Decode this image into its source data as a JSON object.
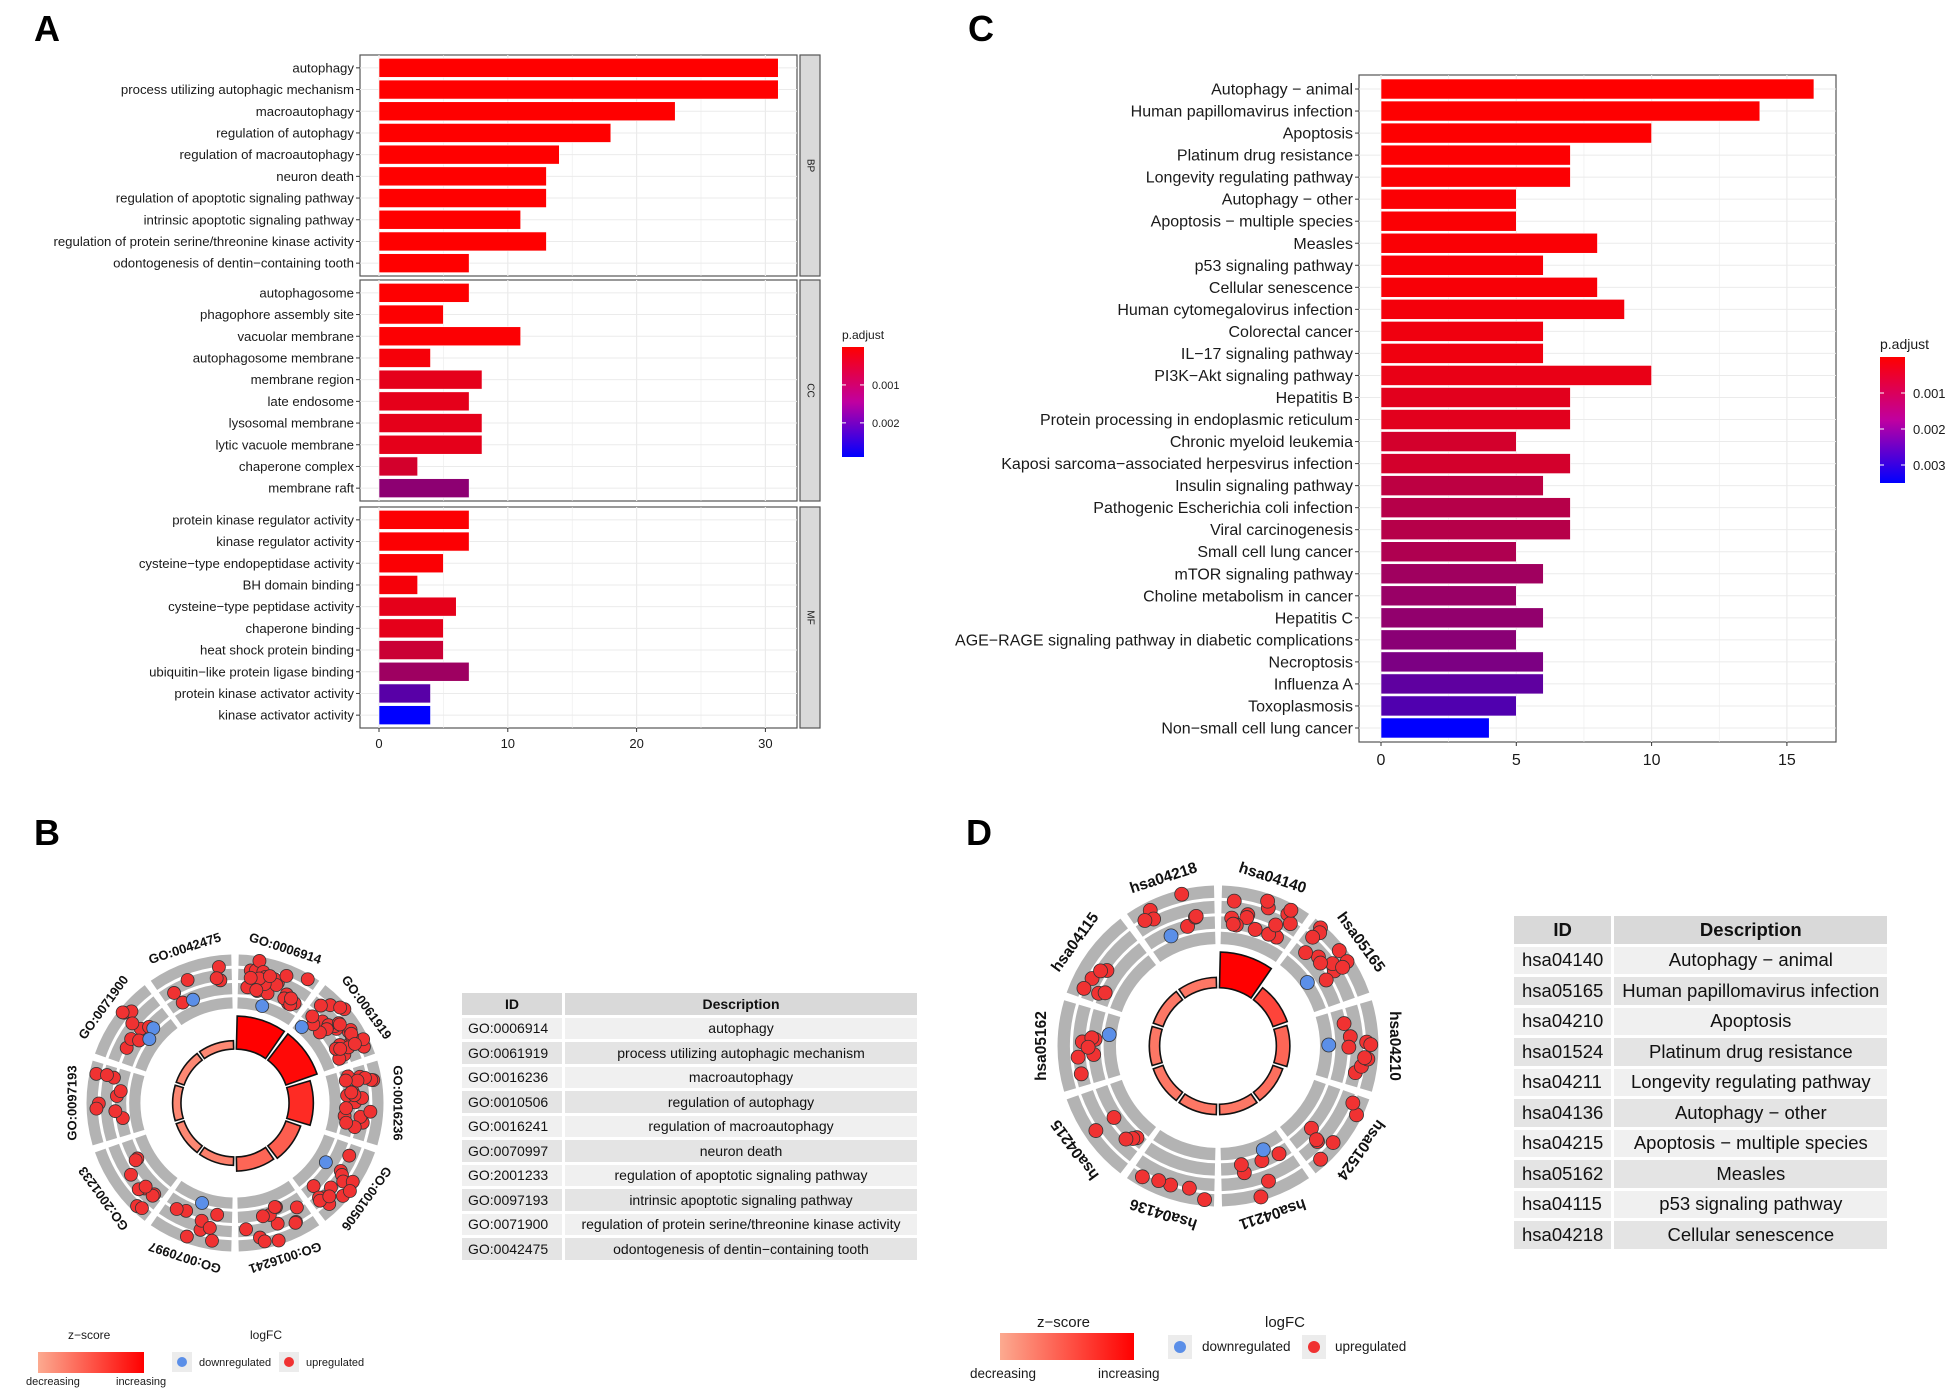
{
  "panels": {
    "A": "A",
    "B": "B",
    "C": "C",
    "D": "D"
  },
  "chart_data": [
    {
      "id": "A",
      "type": "bar",
      "orientation": "horizontal",
      "title": "",
      "xlabel": "",
      "ylabel": "",
      "xlim": [
        0,
        33
      ],
      "xticks": [
        0,
        10,
        20,
        30
      ],
      "grid": true,
      "facets": [
        {
          "name": "BP",
          "categories": [
            "autophagy",
            "process utilizing autophagic mechanism",
            "macroautophagy",
            "regulation of autophagy",
            "regulation of macroautophagy",
            "neuron death",
            "regulation of apoptotic signaling pathway",
            "intrinsic apoptotic signaling pathway",
            "regulation of protein serine/threonine kinase activity",
            "odontogenesis of dentin−containing tooth"
          ],
          "values": [
            31,
            31,
            23,
            18,
            14,
            13,
            13,
            11,
            13,
            7
          ],
          "p_adjust": [
            1e-08,
            1e-08,
            2e-08,
            5e-08,
            1e-07,
            2e-07,
            3e-07,
            3e-07,
            4e-07,
            5e-07
          ]
        },
        {
          "name": "CC",
          "categories": [
            "autophagosome",
            "phagophore assembly site",
            "vacuolar membrane",
            "autophagosome membrane",
            "membrane region",
            "late endosome",
            "lysosomal membrane",
            "lytic vacuole membrane",
            "chaperone complex",
            "membrane raft"
          ],
          "values": [
            7,
            5,
            11,
            4,
            8,
            7,
            8,
            8,
            3,
            7
          ],
          "p_adjust": [
            1e-05,
            2e-05,
            3e-05,
            0.0001,
            0.0003,
            0.0003,
            0.0003,
            0.0003,
            0.0005,
            0.0013
          ]
        },
        {
          "name": "MF",
          "categories": [
            "protein kinase regulator activity",
            "kinase regulator activity",
            "cysteine−type endopeptidase activity",
            "BH domain binding",
            "cysteine−type peptidase activity",
            "chaperone binding",
            "heat shock protein binding",
            "ubiquitin−like protein ligase binding",
            "protein kinase activator activity",
            "kinase activator activity"
          ],
          "values": [
            7,
            7,
            5,
            3,
            6,
            5,
            5,
            7,
            4,
            4
          ],
          "p_adjust": [
            3e-05,
            3e-05,
            5e-05,
            0.0001,
            0.0003,
            0.0003,
            0.0006,
            0.0011,
            0.0019,
            0.0029
          ]
        }
      ],
      "legend": {
        "title": "p.adjust",
        "ticks": [
          "0.001",
          "0.002"
        ],
        "tick_values": [
          0.001,
          0.002
        ],
        "range": [
          0,
          0.0029
        ],
        "low_color": "#ff0000",
        "high_color": "#0000ff",
        "position": "right"
      }
    },
    {
      "id": "C",
      "type": "bar",
      "orientation": "horizontal",
      "title": "",
      "xlabel": "",
      "ylabel": "",
      "xlim": [
        0,
        16.8
      ],
      "xticks": [
        0,
        5,
        10,
        15
      ],
      "grid": true,
      "categories": [
        "Autophagy − animal",
        "Human papillomavirus infection",
        "Apoptosis",
        "Platinum drug resistance",
        "Longevity regulating pathway",
        "Autophagy − other",
        "Apoptosis − multiple species",
        "Measles",
        "p53 signaling pathway",
        "Cellular senescence",
        "Human cytomegalovirus infection",
        "Colorectal cancer",
        "IL−17 signaling pathway",
        "PI3K−Akt signaling pathway",
        "Hepatitis B",
        "Protein processing in endoplasmic reticulum",
        "Chronic myeloid leukemia",
        "Kaposi sarcoma−associated herpesvirus infection",
        "Insulin signaling pathway",
        "Pathogenic Escherichia coli infection",
        "Viral carcinogenesis",
        "Small cell lung cancer",
        "mTOR signaling pathway",
        "Choline metabolism in cancer",
        "Hepatitis C",
        "AGE−RAGE signaling pathway in diabetic complications",
        "Necroptosis",
        "Influenza A",
        "Toxoplasmosis",
        "Non−small cell lung cancer"
      ],
      "values": [
        16,
        14,
        10,
        7,
        7,
        5,
        5,
        8,
        6,
        8,
        9,
        6,
        6,
        10,
        7,
        7,
        5,
        7,
        6,
        7,
        7,
        5,
        6,
        5,
        6,
        5,
        6,
        6,
        5,
        4
      ],
      "p_adjust": [
        1e-06,
        1e-05,
        2e-05,
        3e-05,
        4e-05,
        5e-05,
        6e-05,
        7e-05,
        0.0001,
        0.0001,
        0.00015,
        0.0002,
        0.0002,
        0.0003,
        0.0004,
        0.0004,
        0.0006,
        0.0006,
        0.0009,
        0.001,
        0.001,
        0.0011,
        0.0013,
        0.0014,
        0.0015,
        0.0016,
        0.0018,
        0.0022,
        0.0024,
        0.0035
      ],
      "legend": {
        "title": "p.adjust",
        "ticks": [
          "0.001",
          "0.002",
          "0.003"
        ],
        "tick_values": [
          0.001,
          0.002,
          0.003
        ],
        "range": [
          0,
          0.0035
        ],
        "low_color": "#ff0000",
        "high_color": "#0000ff",
        "position": "right"
      }
    },
    {
      "id": "B",
      "type": "circle",
      "title": "",
      "terms": [
        "GO:0006914",
        "GO:0061919",
        "GO:0016236",
        "GO:0010506",
        "GO:0016241",
        "GO:0070997",
        "GO:2001233",
        "GO:0097193",
        "GO:0071900",
        "GO:0042475"
      ],
      "zscore_intensity": [
        1.0,
        0.95,
        0.75,
        0.45,
        0.4,
        0.25,
        0.2,
        0.2,
        0.2,
        0.2
      ],
      "inner_bar_size": [
        1.0,
        1.0,
        0.7,
        0.4,
        0.35,
        0.15,
        0.15,
        0.15,
        0.15,
        0.15
      ],
      "up_counts": [
        28,
        28,
        20,
        14,
        12,
        8,
        10,
        9,
        9,
        6
      ],
      "down_counts": [
        1,
        1,
        0,
        1,
        0,
        1,
        0,
        0,
        2,
        1
      ],
      "legend": {
        "zscore_title": "z−score",
        "zscore_low": "decreasing",
        "zscore_high": "increasing",
        "logfc_title": "logFC",
        "down_label": "downregulated",
        "up_label": "upregulated",
        "down_color": "#5b8fe8",
        "up_color": "#f03232"
      }
    },
    {
      "id": "D",
      "type": "circle",
      "title": "",
      "terms": [
        "hsa04140",
        "hsa05165",
        "hsa04210",
        "hsa01524",
        "hsa04211",
        "hsa04136",
        "hsa04215",
        "hsa05162",
        "hsa04115",
        "hsa04218"
      ],
      "zscore_intensity": [
        1.0,
        0.6,
        0.4,
        0.35,
        0.3,
        0.3,
        0.3,
        0.3,
        0.3,
        0.3
      ],
      "inner_bar_size": [
        1.0,
        0.35,
        0.3,
        0.2,
        0.2,
        0.2,
        0.2,
        0.2,
        0.2,
        0.2
      ],
      "up_counts": [
        15,
        12,
        9,
        7,
        6,
        5,
        5,
        7,
        6,
        7
      ],
      "down_counts": [
        0,
        1,
        1,
        0,
        1,
        0,
        0,
        1,
        0,
        1
      ],
      "legend": {
        "zscore_title": "z−score",
        "zscore_low": "decreasing",
        "zscore_high": "increasing",
        "logfc_title": "logFC",
        "down_label": "downregulated",
        "up_label": "upregulated",
        "down_color": "#5b8fe8",
        "up_color": "#f03232"
      }
    }
  ],
  "tableB": {
    "headers": [
      "ID",
      "Description"
    ],
    "rows": [
      [
        "GO:0006914",
        "autophagy"
      ],
      [
        "GO:0061919",
        "process utilizing autophagic mechanism"
      ],
      [
        "GO:0016236",
        "macroautophagy"
      ],
      [
        "GO:0010506",
        "regulation of autophagy"
      ],
      [
        "GO:0016241",
        "regulation of macroautophagy"
      ],
      [
        "GO:0070997",
        "neuron death"
      ],
      [
        "GO:2001233",
        "regulation of apoptotic signaling pathway"
      ],
      [
        "GO:0097193",
        "intrinsic apoptotic signaling pathway"
      ],
      [
        "GO:0071900",
        "regulation of protein serine/threonine kinase activity"
      ],
      [
        "GO:0042475",
        "odontogenesis of dentin−containing tooth"
      ]
    ]
  },
  "tableD": {
    "headers": [
      "ID",
      "Description"
    ],
    "rows": [
      [
        "hsa04140",
        "Autophagy − animal"
      ],
      [
        "hsa05165",
        "Human papillomavirus infection"
      ],
      [
        "hsa04210",
        "Apoptosis"
      ],
      [
        "hsa01524",
        "Platinum drug resistance"
      ],
      [
        "hsa04211",
        "Longevity regulating pathway"
      ],
      [
        "hsa04136",
        "Autophagy − other"
      ],
      [
        "hsa04215",
        "Apoptosis − multiple species"
      ],
      [
        "hsa05162",
        "Measles"
      ],
      [
        "hsa04115",
        "p53 signaling pathway"
      ],
      [
        "hsa04218",
        "Cellular senescence"
      ]
    ]
  }
}
